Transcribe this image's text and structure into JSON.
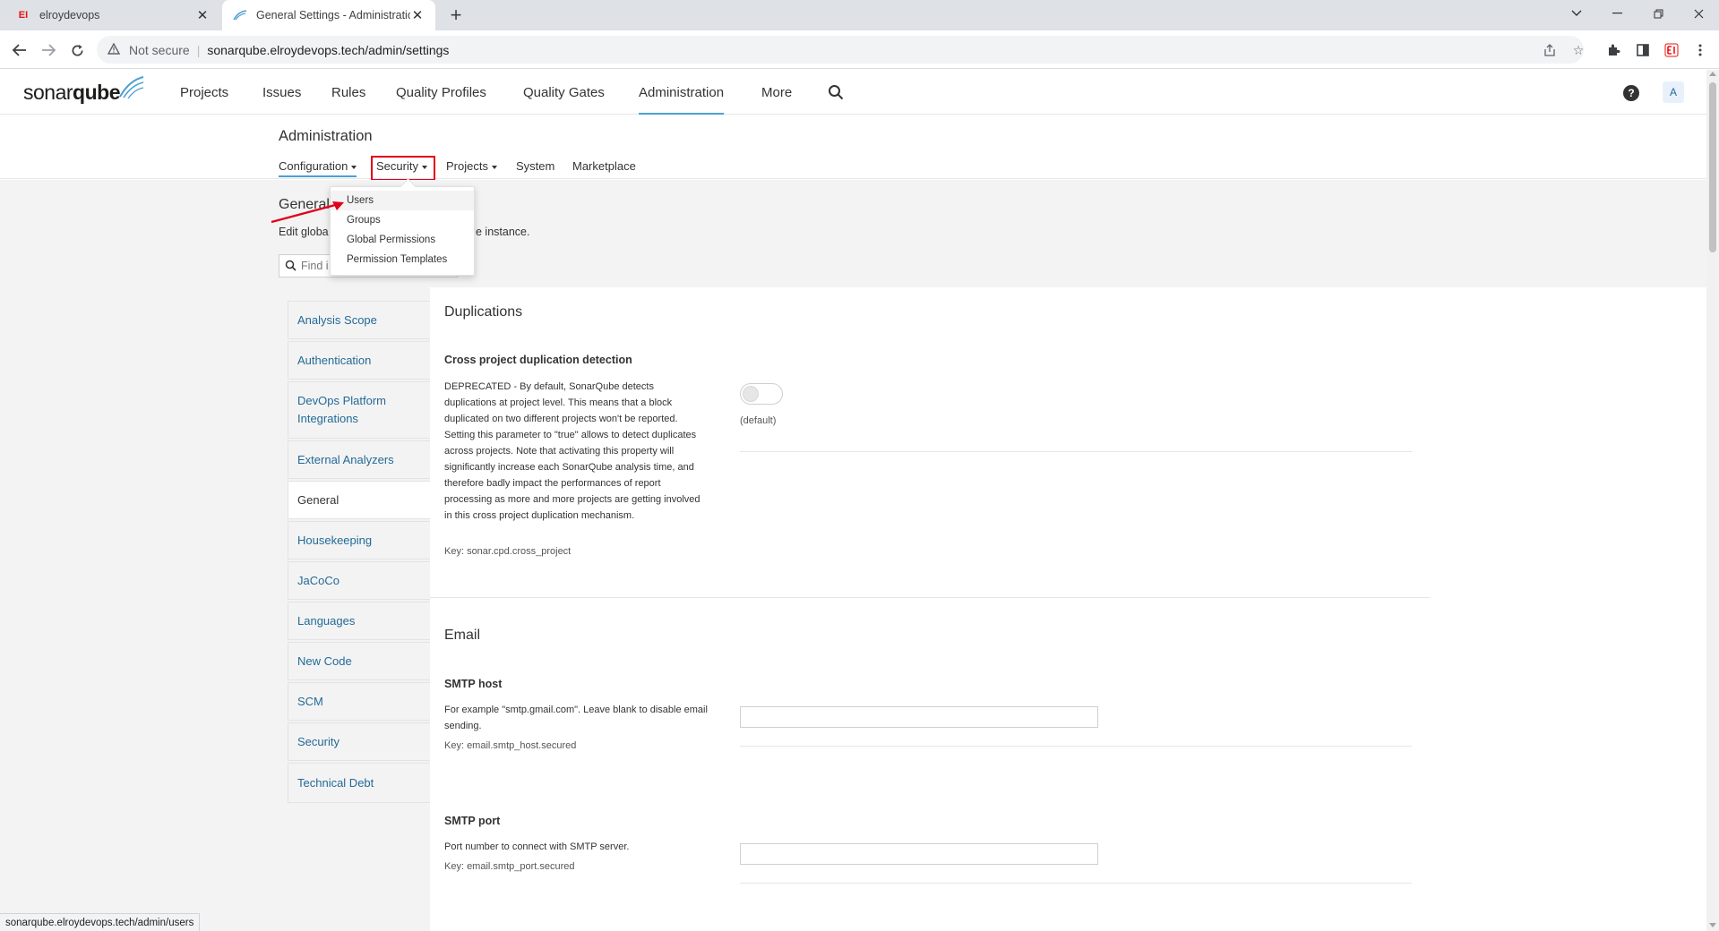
{
  "browser": {
    "tabs": [
      {
        "title": "elroydevops",
        "favicon": "EI"
      },
      {
        "title": "General Settings - Administration"
      }
    ],
    "omnibox": {
      "security": "Not secure",
      "url": "sonarqube.elroydevops.tech/admin/settings"
    },
    "status_url": "sonarqube.elroydevops.tech/admin/users"
  },
  "sonar": {
    "nav": [
      "Projects",
      "Issues",
      "Rules",
      "Quality Profiles",
      "Quality Gates",
      "Administration",
      "More"
    ],
    "avatar": "A"
  },
  "admin": {
    "title": "Administration",
    "tabs": [
      "Configuration",
      "Security",
      "Projects",
      "System",
      "Marketplace"
    ]
  },
  "security_menu": [
    "Users",
    "Groups",
    "Global Permissions",
    "Permission Templates"
  ],
  "general": {
    "title": "General",
    "desc_start": "Edit globa",
    "desc_end": "e instance.",
    "search_placeholder": "Find i"
  },
  "categories": [
    "Analysis Scope",
    "Authentication",
    "DevOps Platform Integrations",
    "External Analyzers",
    "General",
    "Housekeeping",
    "JaCoCo",
    "Languages",
    "New Code",
    "SCM",
    "Security",
    "Technical Debt"
  ],
  "sections": {
    "duplications": {
      "title": "Duplications",
      "setting": "Cross project duplication detection",
      "desc": "DEPRECATED - By default, SonarQube detects duplications at project level. This means that a block duplicated on two different projects won't be reported. Setting this parameter to \"true\" allows to detect duplicates across projects. Note that activating this property will significantly increase each SonarQube analysis time, and therefore badly impact the performances of report processing as more and more projects are getting involved in this cross project duplication mechanism.",
      "key": "Key: sonar.cpd.cross_project",
      "default": "(default)"
    },
    "email": {
      "title": "Email",
      "smtp_host": {
        "name": "SMTP host",
        "desc": "For example \"smtp.gmail.com\". Leave blank to disable email sending.",
        "key": "Key: email.smtp_host.secured"
      },
      "smtp_port": {
        "name": "SMTP port",
        "desc": "Port number to connect with SMTP server.",
        "key": "Key: email.smtp_port.secured"
      }
    }
  },
  "colors": {
    "accent": "#4b9fd5",
    "link": "#236a97",
    "highlight": "#e0001b"
  }
}
